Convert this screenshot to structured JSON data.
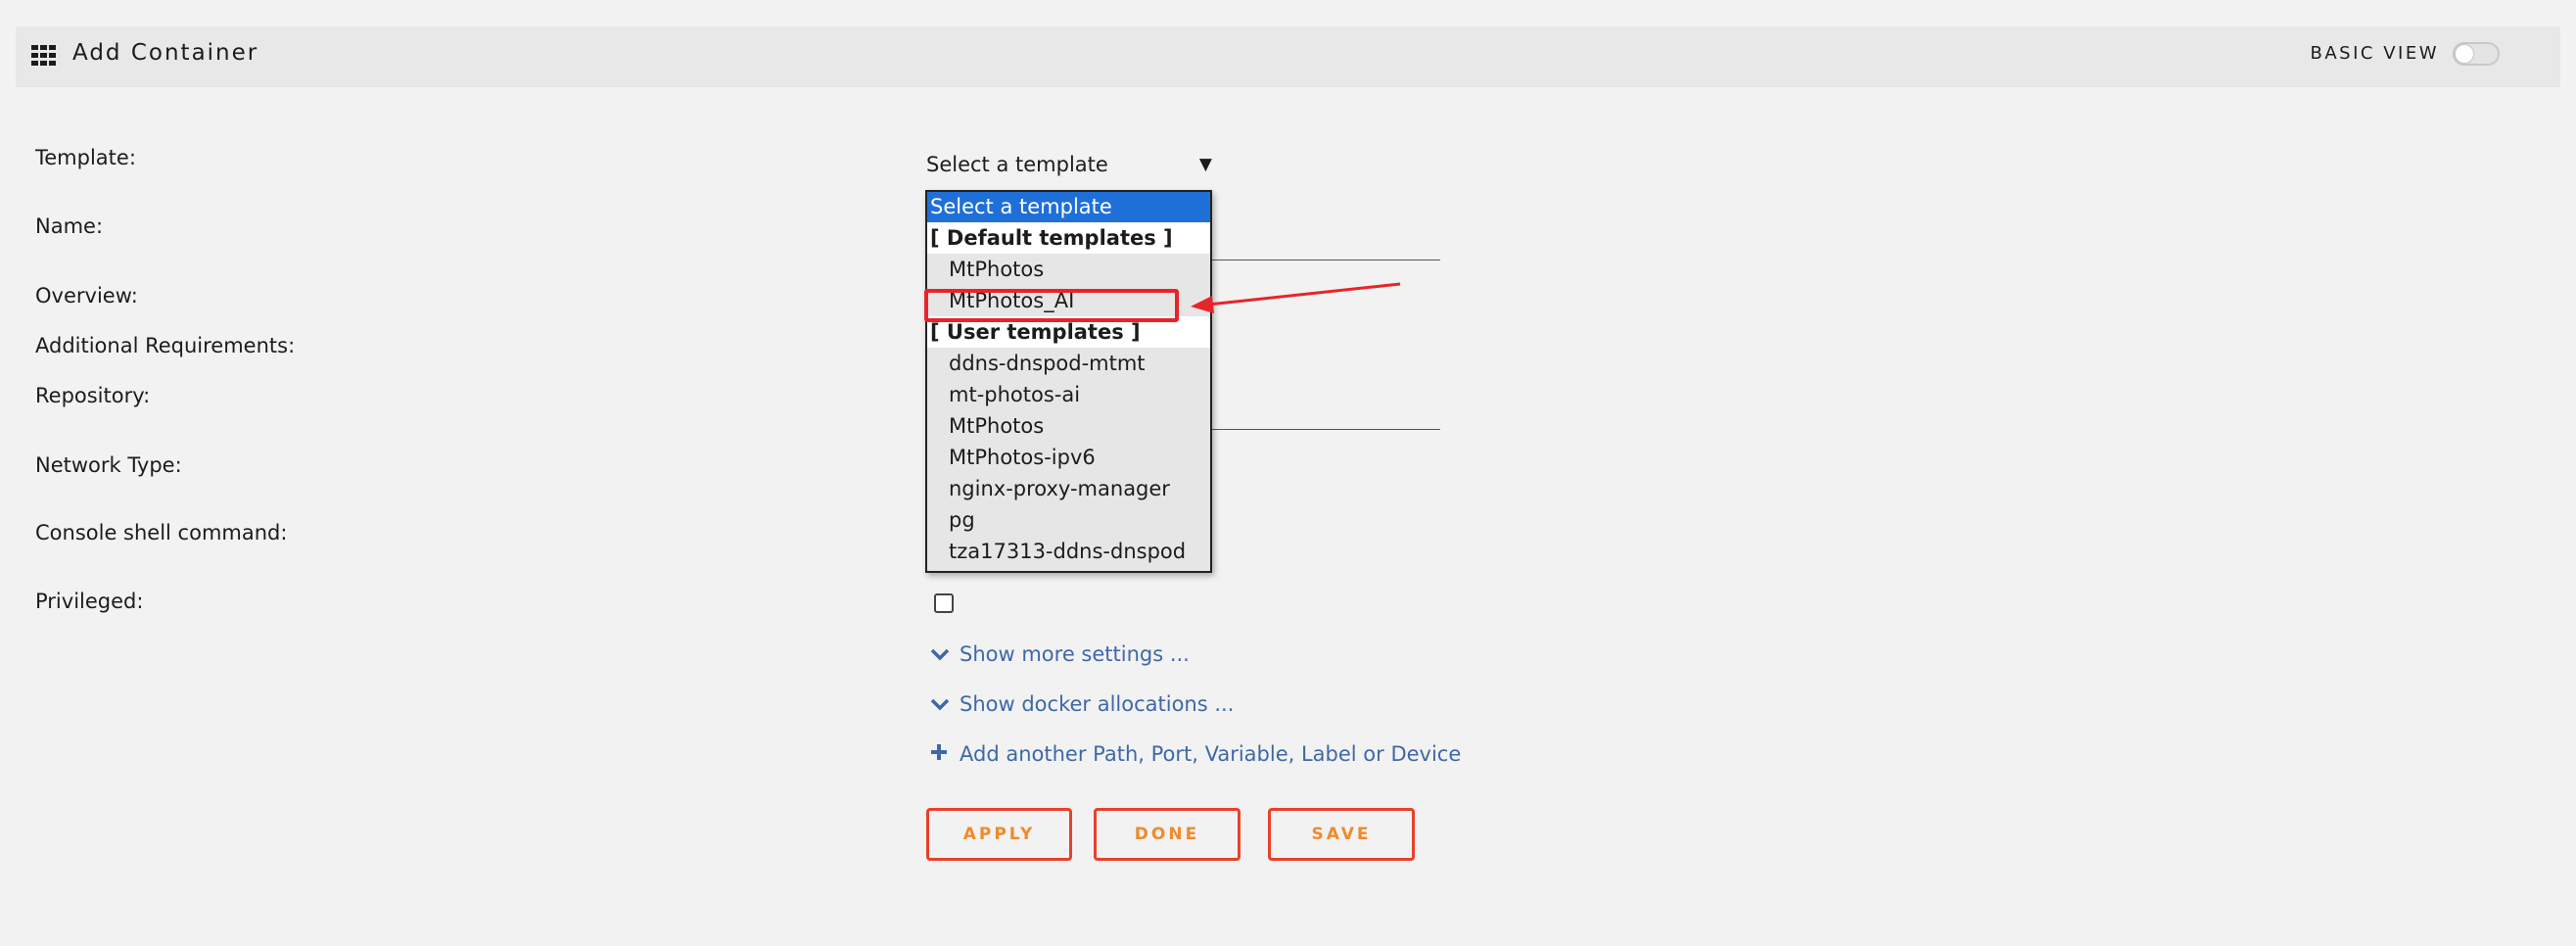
{
  "header": {
    "title": "Add Container",
    "basic_view_label": "BASIC VIEW",
    "toggle_on": false
  },
  "form": {
    "labels": {
      "template": "Template:",
      "name": "Name:",
      "overview": "Overview:",
      "additional": "Additional Requirements:",
      "repository": "Repository:",
      "network": "Network Type:",
      "console": "Console shell command:",
      "privileged": "Privileged:"
    },
    "template_select": {
      "value": "Select a template",
      "caret": "▼"
    },
    "privileged_checked": false
  },
  "dropdown": {
    "selected": "Select a template",
    "default_group": "[ Default templates ]",
    "default_items": [
      "MtPhotos",
      "MtPhotos_AI"
    ],
    "user_group": "[ User templates ]",
    "user_items": [
      "ddns-dnspod-mtmt",
      "mt-photos-ai",
      "MtPhotos",
      "MtPhotos-ipv6",
      "nginx-proxy-manager",
      "pg",
      "tza17313-ddns-dnspod"
    ]
  },
  "links": {
    "more_settings": "Show more settings ...",
    "docker_allocations": "Show docker allocations ...",
    "add_another": "Add another Path, Port, Variable, Label or Device"
  },
  "buttons": {
    "apply": "APPLY",
    "done": "DONE",
    "save": "SAVE"
  },
  "colors": {
    "accent_blue": "#1f6fd9",
    "link_blue": "#3f68a8",
    "button_orange": "#f08a2c",
    "annotation_red": "#e8242a"
  }
}
